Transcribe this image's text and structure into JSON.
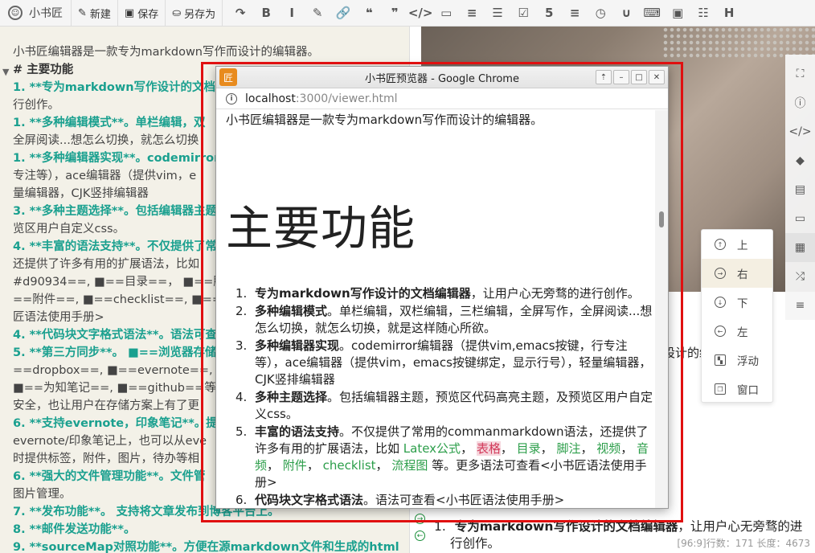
{
  "toolbar": {
    "logo_text": "小书匠",
    "buttons": [
      {
        "icon": "edit-icon",
        "label": "新建"
      },
      {
        "icon": "save-icon",
        "label": "保存"
      },
      {
        "icon": "save-as-icon",
        "label": "另存为"
      }
    ],
    "icons": [
      "share-icon",
      "bold-icon",
      "italic-icon",
      "brush-icon",
      "link-icon",
      "quote-open-icon",
      "quote-close-icon",
      "code-icon",
      "file-icon",
      "ordered-list-icon",
      "unordered-list-icon",
      "checklist-icon",
      "html5-icon",
      "menu-icon",
      "clock-icon",
      "magnet-icon",
      "keyboard-icon",
      "image-icon",
      "list-icon",
      "heading-icon"
    ],
    "icon_glyphs": [
      "↷",
      "B",
      "I",
      "✎",
      "🔗",
      "❝",
      "❞",
      "</>",
      "▭",
      "≡",
      "☰",
      "☑",
      "5",
      "≡",
      "◷",
      "∪",
      "⌨",
      "▣",
      "☷",
      "H"
    ]
  },
  "editor": {
    "lines": [
      {
        "text": "小书匠编辑器是一款专为markdown写作而设计的编辑器。",
        "type": "plain"
      },
      {
        "text": "# 主要功能",
        "type": "heading"
      },
      {
        "text": "1. **专为markdown写作设计的文档",
        "type": "hl"
      },
      {
        "text": "行创作。",
        "type": "plain"
      },
      {
        "text": "1. **多种编辑模式**。单栏编辑，双",
        "type": "hl"
      },
      {
        "text": "全屏阅读...想怎么切换，就怎么切换",
        "type": "plain"
      },
      {
        "text": "1. **多种编辑器实现**。codemirror编",
        "type": "hl"
      },
      {
        "text": "专注等），ace编辑器（提供vim，e",
        "type": "plain"
      },
      {
        "text": "量编辑器，CJK竖排编辑器",
        "type": "plain"
      },
      {
        "text": "3. **多种主题选择**。包括编辑器主题",
        "type": "hl"
      },
      {
        "text": "览区用户自定义css。",
        "type": "plain"
      },
      {
        "text": "4. **丰富的语法支持**。不仅提供了常",
        "type": "hl"
      },
      {
        "text": "还提供了许多有用的扩展语法，比如",
        "type": "plain"
      },
      {
        "text": "#d90934==, ■==目录==， ■==脚注",
        "type": "plain"
      },
      {
        "text": "==附件==, ■==checklist==, ■==流程",
        "type": "plain"
      },
      {
        "text": "匠语法使用手册>",
        "type": "plain"
      },
      {
        "text": "4. **代码块文字格式语法**。语法可查",
        "type": "hl"
      },
      {
        "text": "5. **第三方同步**。 ■==浏览器存储",
        "type": "hl"
      },
      {
        "text": "==dropbox==, ■==evernote==, ■==",
        "type": "plain"
      },
      {
        "text": "■==为知笔记==, ■==github==等多种",
        "type": "plain"
      },
      {
        "text": "安全，也让用户在存储方案上有了更",
        "type": "plain"
      },
      {
        "text": "6. **支持evernote，印象笔记**。提",
        "type": "hl"
      },
      {
        "text": "evernote/印象笔记上，也可以从eve",
        "type": "plain"
      },
      {
        "text": "时提供标签，附件，图片，待办等相",
        "type": "plain"
      },
      {
        "text": "6. **强大的文件管理功能**。文件管",
        "type": "hl"
      },
      {
        "text": "图片管理。",
        "type": "plain"
      },
      {
        "text": "7. **发布功能**。 支持将文章发布到博客平台上。",
        "type": "hl"
      },
      {
        "text": "8. **邮件发送功能**。",
        "type": "hl"
      },
      {
        "text": "9. **sourceMap对照功能**。方便在源markdown文件和生成的html",
        "type": "hl"
      }
    ]
  },
  "preview": {
    "right_fragment": "设计的编",
    "bottom_item_num": "1.",
    "bottom_item_bold": "专为markdown写作设计的文档编辑器",
    "bottom_item_rest": "，让用户心无旁骛的进",
    "bottom_item_cont": "行创作。",
    "status": "[96:9]行数：171 长度：4673"
  },
  "side_tools": [
    "expand-icon",
    "info-icon",
    "code-icon",
    "drop-icon",
    "archive-icon",
    "monitor-icon",
    "grid-icon",
    "shuffle-icon",
    "menu-icon"
  ],
  "side_glyphs": [
    "⛶",
    "ⓘ",
    "</>",
    "◆",
    "▤",
    "▭",
    "▦",
    "⤮",
    "≡"
  ],
  "layout_menu": {
    "items": [
      {
        "icon": "arrow-up-icon",
        "glyph": "↑",
        "label": "上"
      },
      {
        "icon": "arrow-right-icon",
        "glyph": "→",
        "label": "右",
        "selected": true
      },
      {
        "icon": "arrow-down-icon",
        "glyph": "↓",
        "label": "下"
      },
      {
        "icon": "arrow-left-icon",
        "glyph": "←",
        "label": "左"
      },
      {
        "icon": "map-icon",
        "glyph": "▚",
        "label": "浮动"
      },
      {
        "icon": "window-icon",
        "glyph": "❐",
        "label": "窗口"
      }
    ]
  },
  "chrome": {
    "title": "小书匠预览器 - Google Chrome",
    "url_host": "localhost",
    "url_rest": ":3000/viewer.html",
    "intro": "小书匠编辑器是一款专为markdown写作而设计的编辑器。",
    "heading": "主要功能",
    "items": [
      {
        "num": "1.",
        "bold": "专为markdown写作设计的文档编辑器",
        "rest": "，让用户心无旁骛的进行创作。"
      },
      {
        "num": "2.",
        "bold": "多种编辑模式",
        "rest": "。单栏编辑，双栏编辑，三栏编辑，全屏写作，全屏阅读...想怎么切换，就怎么切换，就是这样随心所欲。"
      },
      {
        "num": "3.",
        "bold": "多种编辑器实现",
        "rest": "。codemirror编辑器（提供vim,emacs按键，行专注等），ace编辑器（提供vim，emacs按键绑定，显示行号），轻量编辑器，CJK竖排编辑器"
      },
      {
        "num": "4.",
        "bold": "多种主题选择",
        "rest": "。包括编辑器主题，预览区代码高亮主题，及预览区用户自定义css。"
      },
      {
        "num": "5.",
        "bold": "丰富的语法支持",
        "rest_before": "。不仅提供了常用的commanmarkdown语法，还提供了许多有用的扩展语法，比如 ",
        "links": [
          "Latex公式",
          "表格",
          "目录",
          "脚注",
          "视频",
          "音频",
          "附件",
          "checklist",
          "流程图"
        ],
        "rest_after": " 等。更多语法可查看<小书匠语法使用手册>"
      },
      {
        "num": "6.",
        "bold": "代码块文字格式语法",
        "rest": "。语法可查看<小书匠语法使用手册>"
      }
    ]
  }
}
